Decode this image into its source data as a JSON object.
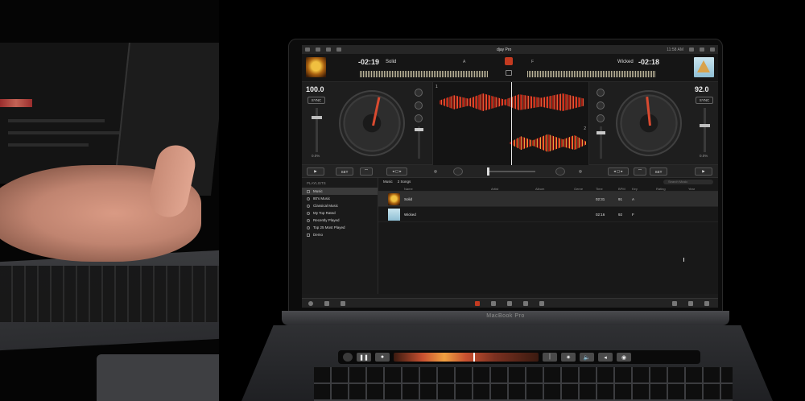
{
  "app": {
    "logo_text": "djay Pro",
    "clock": "11:58 AM"
  },
  "deck_left": {
    "time": "-02:19",
    "title": "Solid",
    "key": "A",
    "bpm": "100.0",
    "sync_label": "SYNC",
    "pitch_pct": "0.0%",
    "number": "1"
  },
  "deck_right": {
    "time": "-02:18",
    "title": "Wicked",
    "key": "F",
    "bpm": "92.0",
    "sync_label": "SYNC",
    "pitch_pct": "0.0%",
    "number": "2"
  },
  "transport": {
    "set_left": "SET",
    "set_right": "SET"
  },
  "library": {
    "sidebar_heading": "PLAYLISTS",
    "playlists": [
      "Music",
      "80's Music",
      "Classical Music",
      "My Top Rated",
      "Recently Played",
      "Top 25 Most Played",
      "Demo"
    ],
    "breadcrumb": "Music",
    "song_count": "2 Songs",
    "search_placeholder": "Search Music",
    "columns": [
      "Name",
      "Artist",
      "Album",
      "Genre",
      "Time",
      "BPM",
      "Key",
      "Rating",
      "Year"
    ],
    "rows": [
      {
        "name": "Solid",
        "time": "02:31",
        "bpm": "91",
        "key": "A"
      },
      {
        "name": "Wicked",
        "time": "02:16",
        "bpm": "92",
        "key": "F"
      }
    ]
  },
  "hardware": {
    "laptop_label": "MacBook Pro"
  },
  "colors": {
    "accent_red": "#c33a20",
    "waveform_orange": "#e0603a"
  }
}
